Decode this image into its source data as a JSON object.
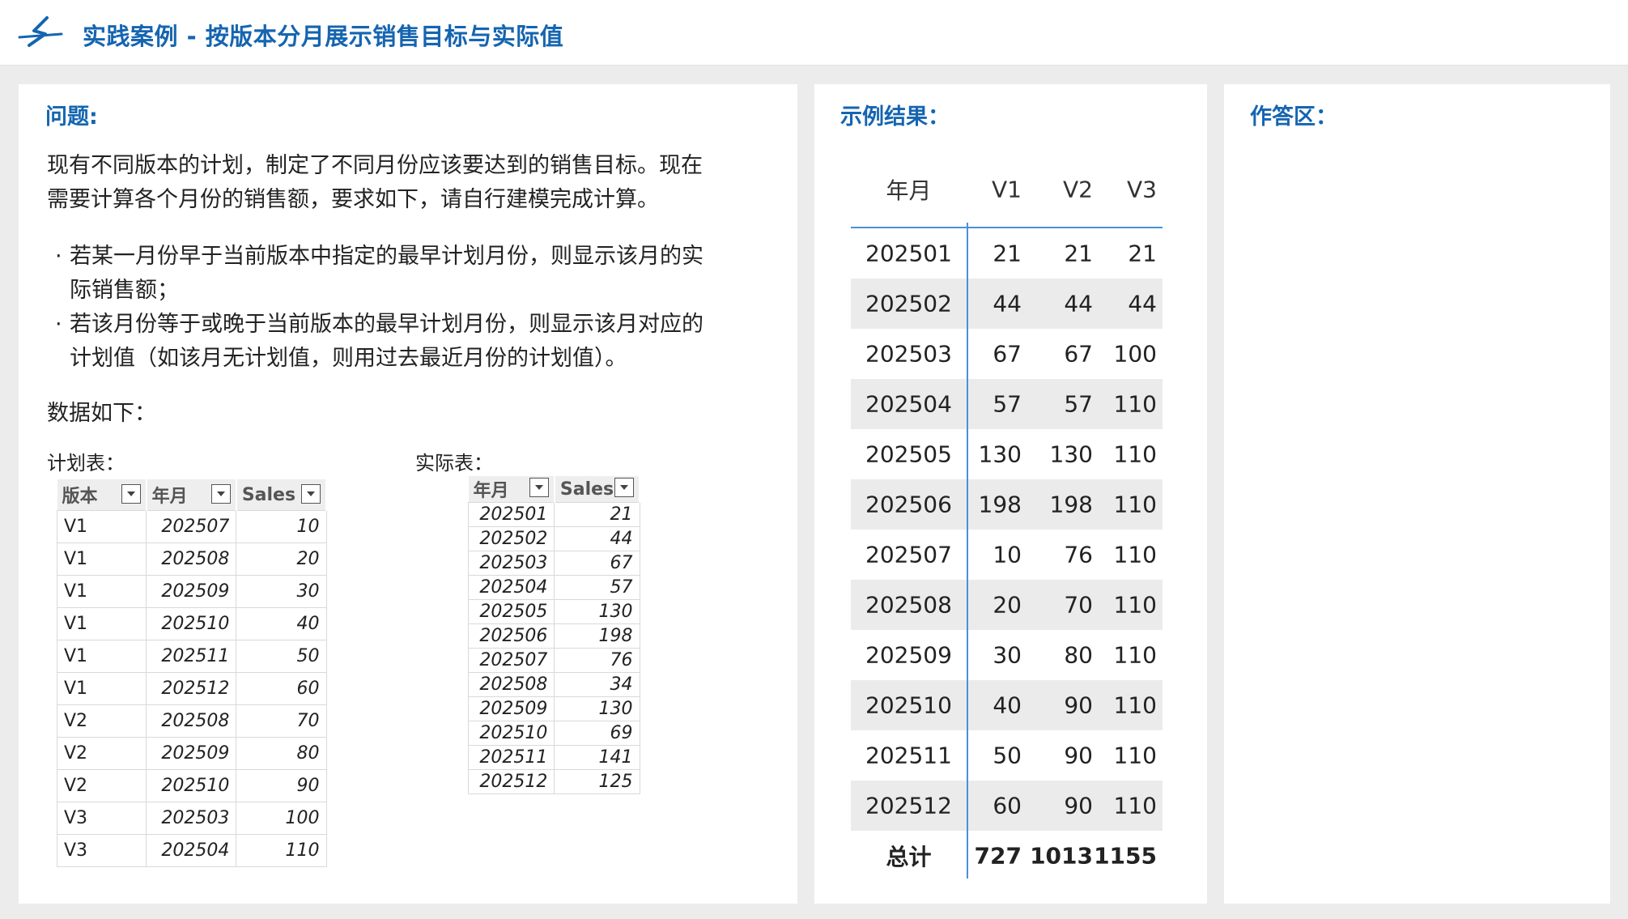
{
  "header": {
    "title": "实践案例 - 按版本分月展示销售目标与实际值",
    "logo_icon": "swoosh-logo-icon"
  },
  "question": {
    "heading": "问题:",
    "intro_line1": "现有不同版本的计划，制定了不同月份应该要达到的销售目标。现在",
    "intro_line2": "需要计算各个月份的销售额，要求如下，请自行建模完成计算。",
    "bullets": [
      {
        "line1": "若某一月份早于当前版本中指定的最早计划月份，则显示该月的实",
        "line2": "际销售额；"
      },
      {
        "line1": "若该月份等于或晚于当前版本的最早计划月份，则显示该月对应的",
        "line2": "计划值（如该月无计划值，则用过去最近月份的计划值）。"
      }
    ],
    "data_label": "数据如下：",
    "plan_label": "计划表：",
    "actual_label": "实际表："
  },
  "plan_table": {
    "headers": [
      "版本",
      "年月",
      "Sales"
    ],
    "rows": [
      [
        "V1",
        "202507",
        "10"
      ],
      [
        "V1",
        "202508",
        "20"
      ],
      [
        "V1",
        "202509",
        "30"
      ],
      [
        "V1",
        "202510",
        "40"
      ],
      [
        "V1",
        "202511",
        "50"
      ],
      [
        "V1",
        "202512",
        "60"
      ],
      [
        "V2",
        "202508",
        "70"
      ],
      [
        "V2",
        "202509",
        "80"
      ],
      [
        "V2",
        "202510",
        "90"
      ],
      [
        "V3",
        "202503",
        "100"
      ],
      [
        "V3",
        "202504",
        "110"
      ]
    ]
  },
  "actual_table": {
    "headers": [
      "年月",
      "Sales"
    ],
    "rows": [
      [
        "202501",
        "21"
      ],
      [
        "202502",
        "44"
      ],
      [
        "202503",
        "67"
      ],
      [
        "202504",
        "57"
      ],
      [
        "202505",
        "130"
      ],
      [
        "202506",
        "198"
      ],
      [
        "202507",
        "76"
      ],
      [
        "202508",
        "34"
      ],
      [
        "202509",
        "130"
      ],
      [
        "202510",
        "69"
      ],
      [
        "202511",
        "141"
      ],
      [
        "202512",
        "125"
      ]
    ]
  },
  "result": {
    "heading": "示例结果：",
    "headers": [
      "年月",
      "V1",
      "V2",
      "V3"
    ],
    "rows": [
      [
        "202501",
        "21",
        "21",
        "21"
      ],
      [
        "202502",
        "44",
        "44",
        "44"
      ],
      [
        "202503",
        "67",
        "67",
        "100"
      ],
      [
        "202504",
        "57",
        "57",
        "110"
      ],
      [
        "202505",
        "130",
        "130",
        "110"
      ],
      [
        "202506",
        "198",
        "198",
        "110"
      ],
      [
        "202507",
        "10",
        "76",
        "110"
      ],
      [
        "202508",
        "20",
        "70",
        "110"
      ],
      [
        "202509",
        "30",
        "80",
        "110"
      ],
      [
        "202510",
        "40",
        "90",
        "110"
      ],
      [
        "202511",
        "50",
        "90",
        "110"
      ],
      [
        "202512",
        "60",
        "90",
        "110"
      ]
    ],
    "total": [
      "总计",
      "727",
      "1013",
      "1155"
    ]
  },
  "answer": {
    "heading": "作答区："
  },
  "colors": {
    "accent": "#1565b0",
    "divider": "#4a90d9",
    "row_shade": "#ebebeb"
  }
}
